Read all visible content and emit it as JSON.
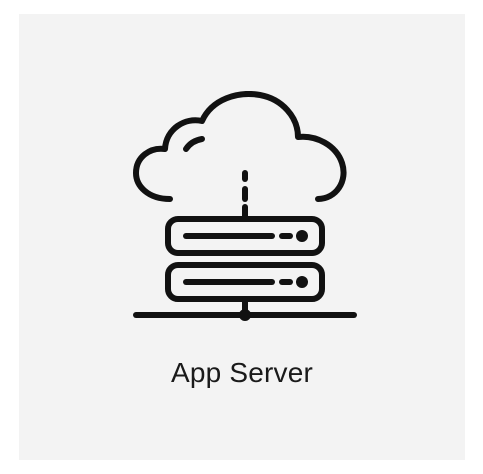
{
  "card": {
    "label": "App Server",
    "icon": "cloud-server-icon",
    "background_color": "#f3f3f3",
    "icon_color": "#111111",
    "text_color": "#1a1a1a"
  }
}
